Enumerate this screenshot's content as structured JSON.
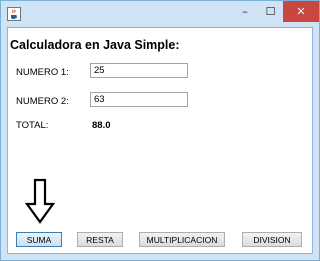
{
  "window": {
    "minimize_glyph": "–",
    "maximize_glyph": "☐",
    "close_glyph": "✕",
    "app_icon": "java-cup-icon"
  },
  "main": {
    "title": "Calculadora en Java Simple:",
    "numero1_label": "NUMERO 1:",
    "numero1_value": "25",
    "numero2_label": "NUMERO 2:",
    "numero2_value": "63",
    "total_label": "TOTAL:",
    "total_value": "88.0"
  },
  "buttons": {
    "suma": "SUMA",
    "resta": "RESTA",
    "multiplicacion": "MULTIPLICACION",
    "division": "DIVISION"
  },
  "colors": {
    "window_frame": "#cfe3f5",
    "close_button": "#c9473e",
    "focus_border": "#3c7fb1"
  }
}
